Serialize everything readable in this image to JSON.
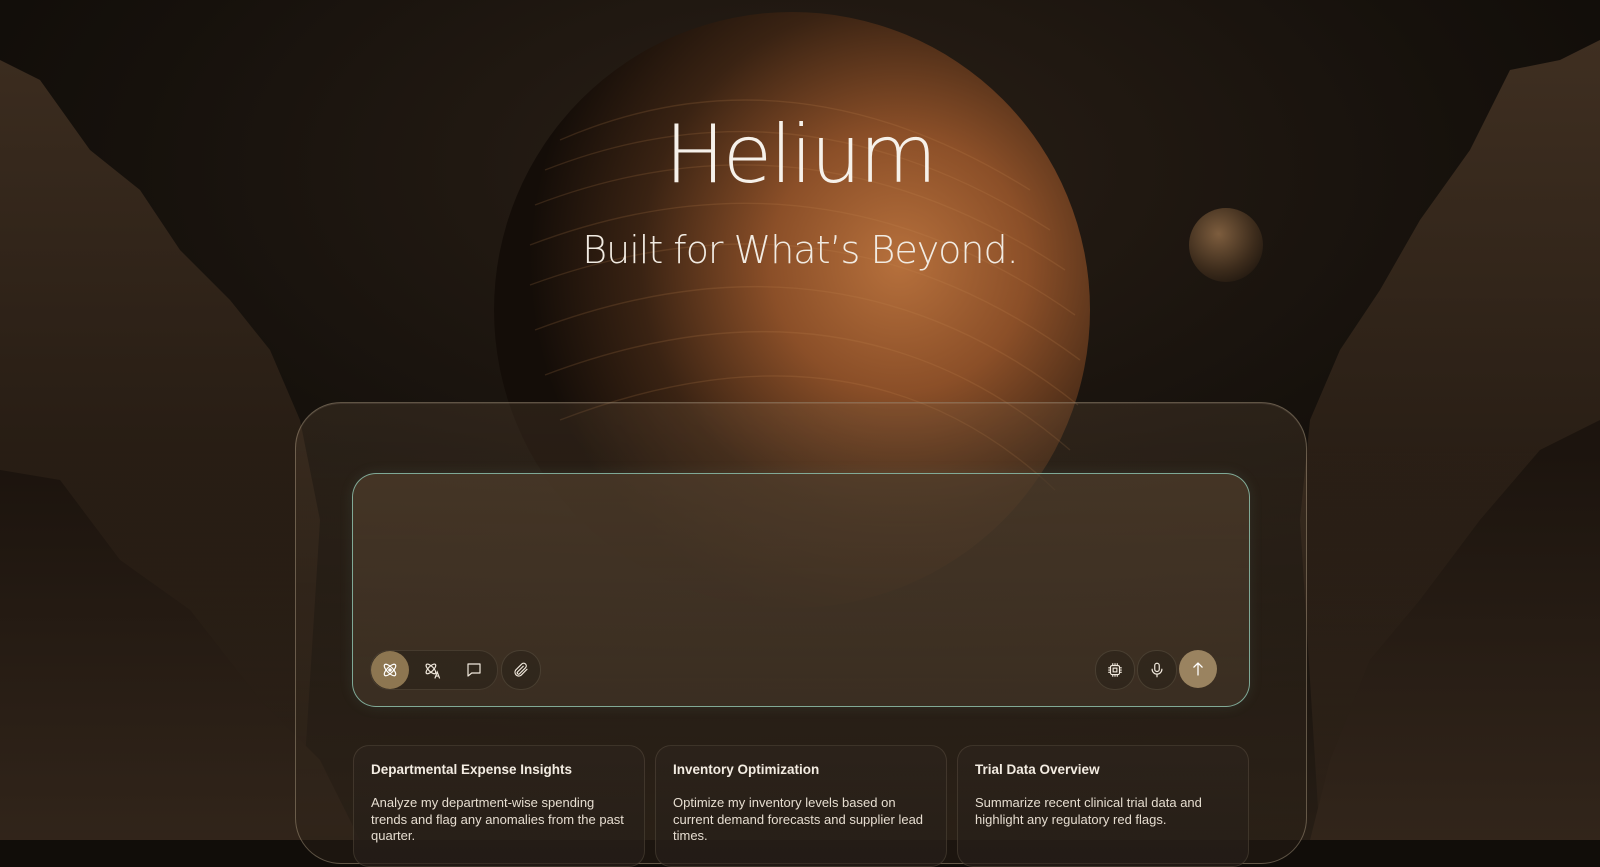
{
  "hero": {
    "title": "Helium",
    "subtitle": "Built for What’s Beyond."
  },
  "composer": {
    "placeholder": "",
    "value": "",
    "left_tools": [
      {
        "icon": "atom-icon",
        "active": true
      },
      {
        "icon": "atom-translate-icon",
        "active": false
      },
      {
        "icon": "chat-bubble-icon",
        "active": false
      }
    ],
    "attach_icon": "paperclip-icon",
    "right_tools": [
      {
        "icon": "cpu-chip-icon"
      },
      {
        "icon": "microphone-icon"
      }
    ],
    "send_icon": "arrow-up-icon",
    "accent_color": "#9a8360",
    "border_color": "#96d2be"
  },
  "suggestions": [
    {
      "title": "Departmental Expense Insights",
      "description": "Analyze my department-wise spending trends and flag any anomalies from the past quarter."
    },
    {
      "title": "Inventory Optimization",
      "description": "Optimize my inventory levels based on current demand forecasts and supplier lead times."
    },
    {
      "title": "Trial Data Overview",
      "description": "Summarize recent clinical trial data and highlight any regulatory red flags."
    }
  ]
}
